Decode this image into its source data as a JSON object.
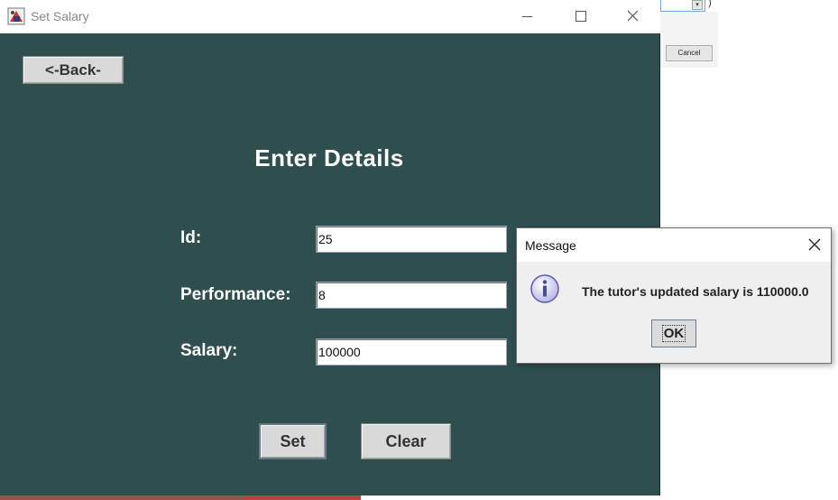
{
  "window": {
    "title": "Set Salary"
  },
  "background_window": {
    "cancel_label": "Cancel",
    "paren": ")"
  },
  "form": {
    "back_label": "<-Back-",
    "heading": "Enter Details",
    "fields": [
      {
        "label": "Id:",
        "value": "25"
      },
      {
        "label": "Performance:",
        "value": "8"
      },
      {
        "label": "Salary:",
        "value": "100000"
      }
    ],
    "set_label": "Set",
    "clear_label": "Clear"
  },
  "dialog": {
    "title": "Message",
    "message": "The tutor's updated salary is 110000.0",
    "ok_label": "OK",
    "icon": "info-icon"
  },
  "colors": {
    "panel_bg": "#2f4f4f",
    "button_bg": "#d9d9d9",
    "dialog_bg": "#efefef"
  }
}
